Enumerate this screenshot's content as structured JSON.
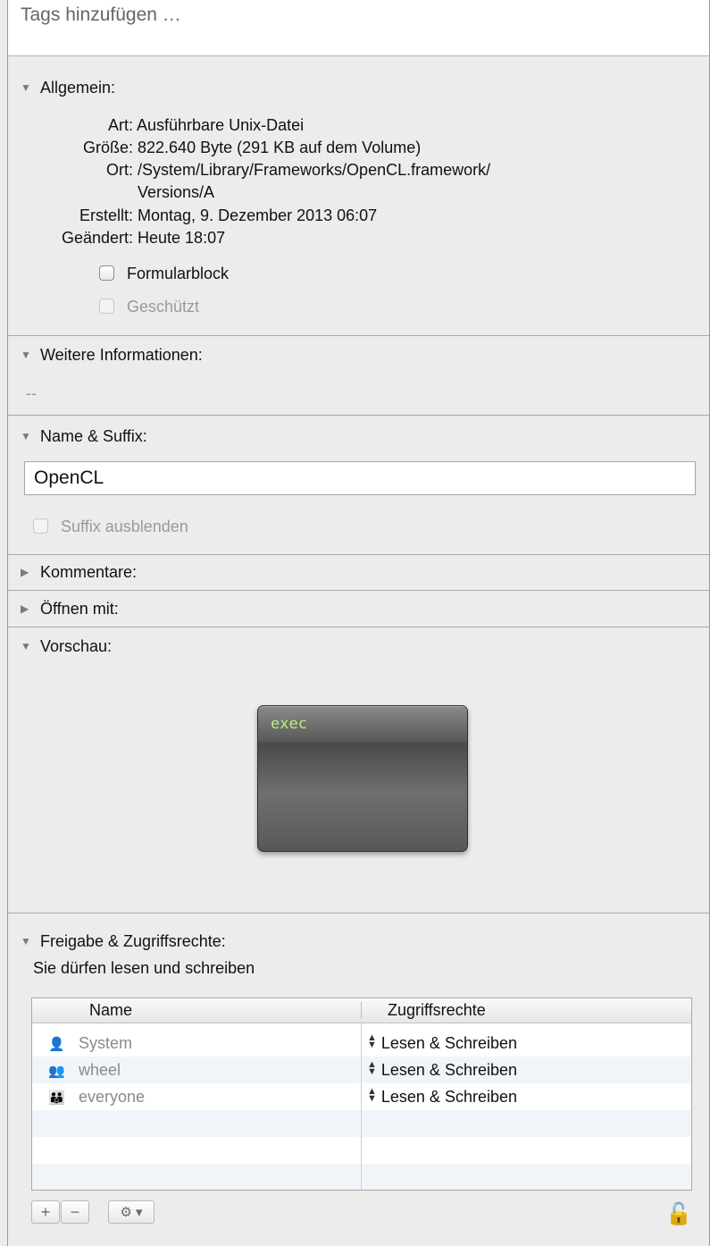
{
  "tags": {
    "placeholder": "Tags hinzufügen …"
  },
  "general": {
    "title": "Allgemein:",
    "labels": {
      "kind": "Art:",
      "size": "Größe:",
      "where": "Ort:",
      "created": "Erstellt:",
      "modified": "Geändert:"
    },
    "values": {
      "kind": "Ausführbare Unix-Datei",
      "size": "822.640 Byte (291 KB auf dem Volume)",
      "where_line1": "/System/Library/Frameworks/OpenCL.framework/",
      "where_line2": "Versions/A",
      "created": "Montag, 9. Dezember 2013 06:07",
      "modified": "Heute 18:07"
    },
    "stationery": "Formularblock",
    "locked": "Geschützt"
  },
  "more_info": {
    "title": "Weitere Informationen:",
    "value": "--"
  },
  "name_ext": {
    "title": "Name & Suffix:",
    "name_value": "OpenCL",
    "hide_ext": "Suffix ausblenden"
  },
  "comments": {
    "title": "Kommentare:"
  },
  "open_with": {
    "title": "Öffnen mit:"
  },
  "preview": {
    "title": "Vorschau:",
    "icon_label": "exec",
    "icon": "executable-icon"
  },
  "sharing": {
    "title": "Freigabe & Zugriffsrechte:",
    "status": "Sie dürfen lesen und schreiben",
    "columns": {
      "name": "Name",
      "privilege": "Zugriffsrechte"
    },
    "rows": [
      {
        "user": "System",
        "privilege": "Lesen & Schreiben",
        "icon": "user-icon"
      },
      {
        "user": "wheel",
        "privilege": "Lesen & Schreiben",
        "icon": "group-icon"
      },
      {
        "user": "everyone",
        "privilege": "Lesen & Schreiben",
        "icon": "everyone-icon"
      }
    ]
  },
  "toolbar": {
    "add": "+",
    "remove": "−",
    "action": "⚙ ▾"
  },
  "colors": {
    "background": "#ececec",
    "exec_text": "#b8f07a",
    "lock": "#c8902a"
  }
}
